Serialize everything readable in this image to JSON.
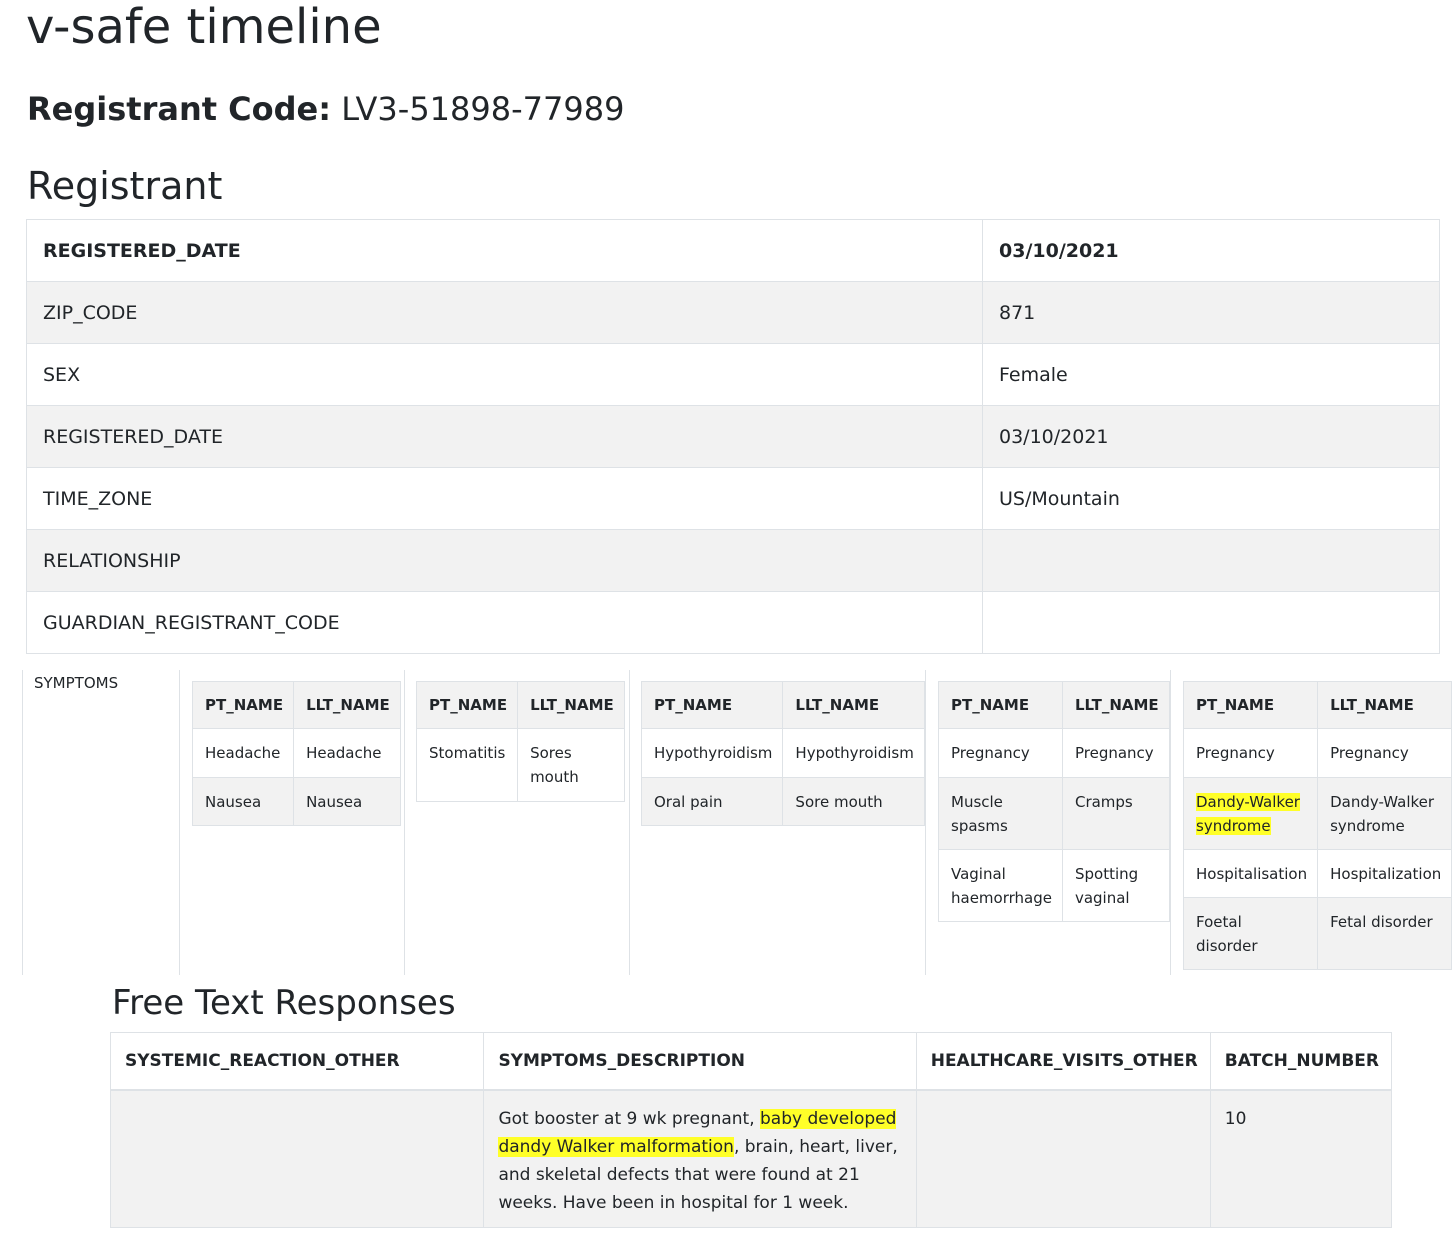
{
  "page": {
    "title": "v-safe timeline",
    "registrant_code_label": "Registrant Code:",
    "registrant_code_value": "LV3-51898-77989",
    "registrant_heading": "Registrant"
  },
  "registrant": {
    "rows": [
      {
        "key": "REGISTERED_DATE",
        "value": "03/10/2021"
      },
      {
        "key": "ZIP_CODE",
        "value": "871"
      },
      {
        "key": "SEX",
        "value": "Female"
      },
      {
        "key": "REGISTERED_DATE",
        "value": "03/10/2021"
      },
      {
        "key": "TIME_ZONE",
        "value": "US/Mountain"
      },
      {
        "key": "RELATIONSHIP",
        "value": ""
      },
      {
        "key": "GUARDIAN_REGISTRANT_CODE",
        "value": ""
      }
    ]
  },
  "symptoms": {
    "label": "SYMPTOMS",
    "col_pt": "PT_NAME",
    "col_llt": "LLT_NAME",
    "groups": [
      {
        "rows": [
          {
            "pt": "Headache",
            "llt": "Headache"
          },
          {
            "pt": "Nausea",
            "llt": "Nausea"
          }
        ]
      },
      {
        "rows": [
          {
            "pt": "Stomatitis",
            "llt": "Sores mouth"
          }
        ]
      },
      {
        "rows": [
          {
            "pt": "Hypothyroidism",
            "llt": "Hypothyroidism"
          },
          {
            "pt": "Oral pain",
            "llt": "Sore mouth"
          }
        ]
      },
      {
        "rows": [
          {
            "pt": "Pregnancy",
            "llt": "Pregnancy"
          },
          {
            "pt": "Muscle spasms",
            "llt": "Cramps"
          },
          {
            "pt": "Vaginal haemorrhage",
            "llt": "Spotting vaginal"
          }
        ]
      },
      {
        "rows": [
          {
            "pt": "Pregnancy",
            "llt": "Pregnancy"
          },
          {
            "pt": "Dandy-Walker syndrome",
            "llt": "Dandy-Walker syndrome"
          },
          {
            "pt": "Hospitalisation",
            "llt": "Hospitalization"
          },
          {
            "pt": "Foetal disorder",
            "llt": "Fetal disorder"
          }
        ]
      }
    ]
  },
  "free_text": {
    "heading": "Free Text Responses",
    "columns": [
      "SYSTEMIC_REACTION_OTHER",
      "SYMPTOMS_DESCRIPTION",
      "HEALTHCARE_VISITS_OTHER",
      "BATCH_NUMBER"
    ],
    "row": {
      "systemic_reaction_other": "",
      "symptoms_description_pre": "Got booster at 9 wk pregnant, ",
      "symptoms_description_highlight": "baby developed dandy Walker malformation",
      "symptoms_description_post": ", brain, heart, liver, and skeletal defects that were found at 21 weeks. Have been in hospital for 1 week.",
      "healthcare_visits_other": "",
      "batch_number": "10"
    }
  },
  "colors": {
    "highlight": "#ffff28",
    "stripe": "#f2f2f2",
    "border": "#dee2e6"
  }
}
